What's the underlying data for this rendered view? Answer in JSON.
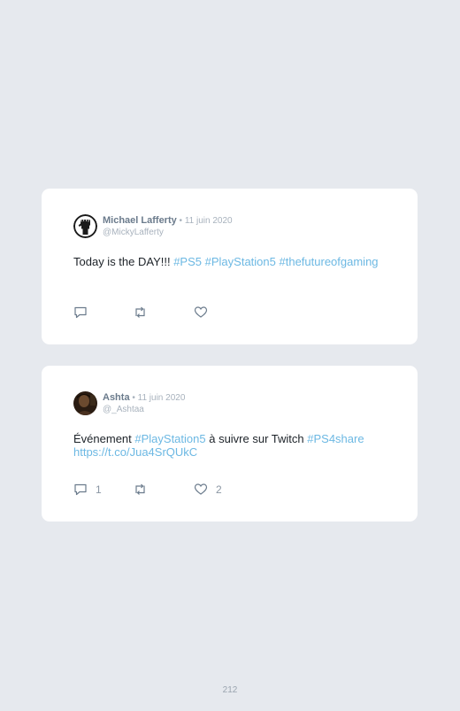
{
  "tweets": [
    {
      "author_name": "Michael Lafferty",
      "separator": " • ",
      "date": "11 juin 2020",
      "handle": "@MickyLafferty",
      "text_parts": [
        {
          "text": "Today is the DAY!!! "
        },
        {
          "text": "#PS5",
          "tag": true
        },
        {
          "text": " "
        },
        {
          "text": "#PlayStation5",
          "tag": true
        },
        {
          "text": " "
        },
        {
          "text": "#thefutureofgaming",
          "tag": true
        }
      ],
      "reply_count": "",
      "retweet_count": "",
      "like_count": ""
    },
    {
      "author_name": "Ashta",
      "separator": " • ",
      "date": "11 juin 2020",
      "handle": "@_Ashtaa",
      "text_parts": [
        {
          "text": "Événement "
        },
        {
          "text": "#PlayStation5",
          "tag": true
        },
        {
          "text": " à suivre sur Twitch "
        },
        {
          "text": "#PS4share",
          "tag": true
        },
        {
          "text": " "
        },
        {
          "text": "https://t.co/Jua4SrQUkC",
          "tag": true
        }
      ],
      "reply_count": "1",
      "retweet_count": "",
      "like_count": "2"
    }
  ],
  "icons": {
    "reply": "reply-icon",
    "retweet": "retweet-icon",
    "like": "heart-icon",
    "avatar_1": "raised-fist-avatar",
    "avatar_2": "person-photo-avatar"
  },
  "colors": {
    "background": "#e6e9ee",
    "card": "#ffffff",
    "hashtag": "#6cb8e3",
    "name": "#6b7b8c",
    "muted": "#a8b2bd",
    "text": "#1c2228"
  },
  "page_number": "212"
}
